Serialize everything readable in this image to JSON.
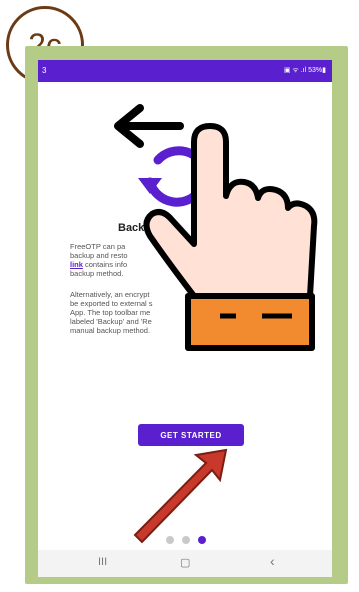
{
  "step_badge": "2c",
  "status_bar": {
    "time": "3",
    "system_icons": "▣ ᯤ .ıl 53%▮"
  },
  "screen": {
    "title": "Backup",
    "paragraph1": [
      {
        "text": "FreeOTP can pa"
      },
      {
        "text": "backup and resto"
      },
      {
        "link": "link",
        "text": " contains info"
      },
      {
        "text": "backup method."
      }
    ],
    "paragraph2": [
      "Alternatively, an encrypt",
      "be exported to external s",
      "App. The top toolbar me",
      "labeled 'Backup' and 'Re",
      "manual backup method."
    ],
    "button_label": "GET STARTED",
    "page_dots": {
      "count": 3,
      "active": 3
    },
    "nav": {
      "recents": "III",
      "home": "▢",
      "back": "‹"
    }
  },
  "colors": {
    "accent": "#5a1fcf",
    "frame": "#b5cc89",
    "badge_border": "#6b3b16",
    "hand_cuff": "#f28a2f",
    "hand_skin": "#ffe1d6",
    "pointer_arrow": "#c8382b"
  },
  "icons": [
    "swipe-left-arrow-icon",
    "sync-icon",
    "pointing-hand-icon",
    "red-pointer-arrow-icon"
  ]
}
